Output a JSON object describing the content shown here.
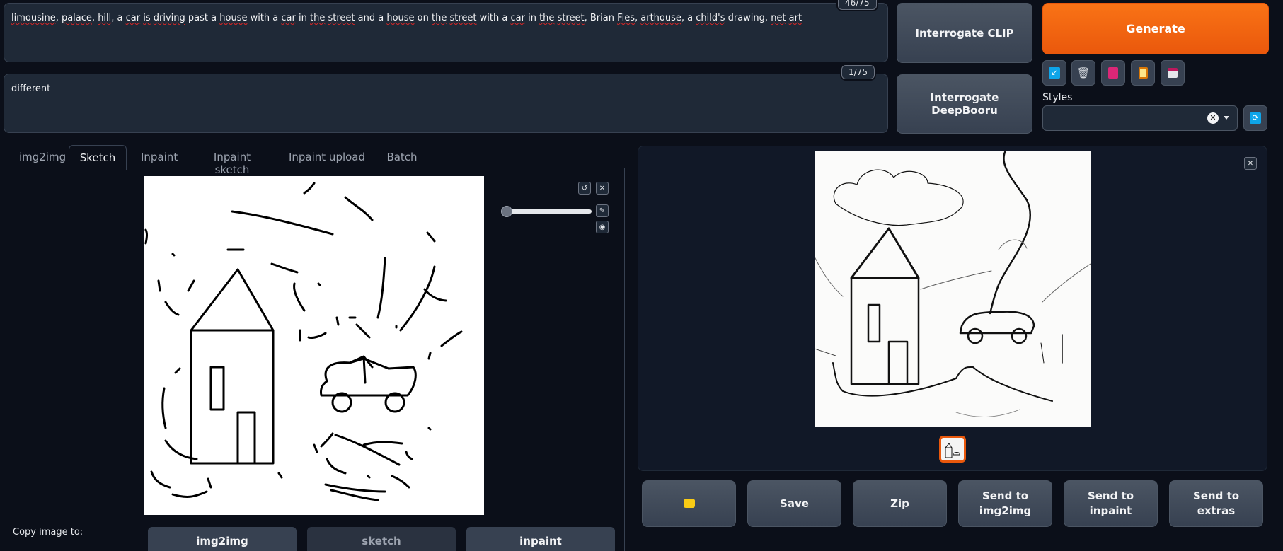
{
  "prompt": {
    "tokens": [
      {
        "t": "limousine",
        "sq": true
      },
      {
        "t": ", ",
        "sq": false
      },
      {
        "t": "palace",
        "sq": true
      },
      {
        "t": ", ",
        "sq": false
      },
      {
        "t": "hill",
        "sq": true
      },
      {
        "t": ", a ",
        "sq": false
      },
      {
        "t": "car",
        "sq": true
      },
      {
        "t": " ",
        "sq": false
      },
      {
        "t": "is",
        "sq": true
      },
      {
        "t": " ",
        "sq": false
      },
      {
        "t": "driving",
        "sq": true
      },
      {
        "t": " past a ",
        "sq": false
      },
      {
        "t": "house",
        "sq": true
      },
      {
        "t": " with a ",
        "sq": false
      },
      {
        "t": "car",
        "sq": true
      },
      {
        "t": " in ",
        "sq": false
      },
      {
        "t": "the",
        "sq": true
      },
      {
        "t": " ",
        "sq": false
      },
      {
        "t": "street",
        "sq": true
      },
      {
        "t": " and a ",
        "sq": false
      },
      {
        "t": "house",
        "sq": true
      },
      {
        "t": " on ",
        "sq": false
      },
      {
        "t": "the",
        "sq": true
      },
      {
        "t": " ",
        "sq": false
      },
      {
        "t": "street",
        "sq": true
      },
      {
        "t": " with a ",
        "sq": false
      },
      {
        "t": "car",
        "sq": true
      },
      {
        "t": " in ",
        "sq": false
      },
      {
        "t": "the",
        "sq": true
      },
      {
        "t": " ",
        "sq": false
      },
      {
        "t": "street",
        "sq": true
      },
      {
        "t": ", Brian ",
        "sq": false
      },
      {
        "t": "Fies",
        "sq": true
      },
      {
        "t": ", ",
        "sq": false
      },
      {
        "t": "arthouse",
        "sq": true
      },
      {
        "t": ", a ",
        "sq": false
      },
      {
        "t": "child's",
        "sq": true
      },
      {
        "t": " drawing, ",
        "sq": false
      },
      {
        "t": "net",
        "sq": true
      },
      {
        "t": " ",
        "sq": false
      },
      {
        "t": "art",
        "sq": true
      }
    ],
    "counter": "46/75"
  },
  "negative_prompt": {
    "text": "different",
    "counter": "1/75"
  },
  "buttons": {
    "interrogate_clip": "Interrogate CLIP",
    "interrogate_deepbooru": "Interrogate DeepBooru",
    "generate": "Generate"
  },
  "styles": {
    "label": "Styles",
    "value": ""
  },
  "tabs": [
    {
      "label": "img2img",
      "active": false
    },
    {
      "label": "Sketch",
      "active": true
    },
    {
      "label": "Inpaint",
      "active": false
    },
    {
      "label": "Inpaint sketch",
      "active": false
    },
    {
      "label": "Inpaint upload",
      "active": false
    },
    {
      "label": "Batch",
      "active": false
    }
  ],
  "copy_to": {
    "label": "Copy image to:",
    "buttons": [
      {
        "label": "img2img",
        "disabled": false
      },
      {
        "label": "sketch",
        "disabled": true
      },
      {
        "label": "inpaint",
        "disabled": false
      }
    ]
  },
  "output_actions": [
    {
      "label": "",
      "icon": "folder-icon"
    },
    {
      "label": "Save"
    },
    {
      "label": "Zip"
    },
    {
      "label": "Send to img2img"
    },
    {
      "label": "Send to inpaint"
    },
    {
      "label": "Send to extras"
    }
  ],
  "brush_slider": {
    "value": 0.0
  },
  "colors": {
    "accent": "#ea580c",
    "background": "#0b0f19",
    "panel": "#1f2937"
  }
}
